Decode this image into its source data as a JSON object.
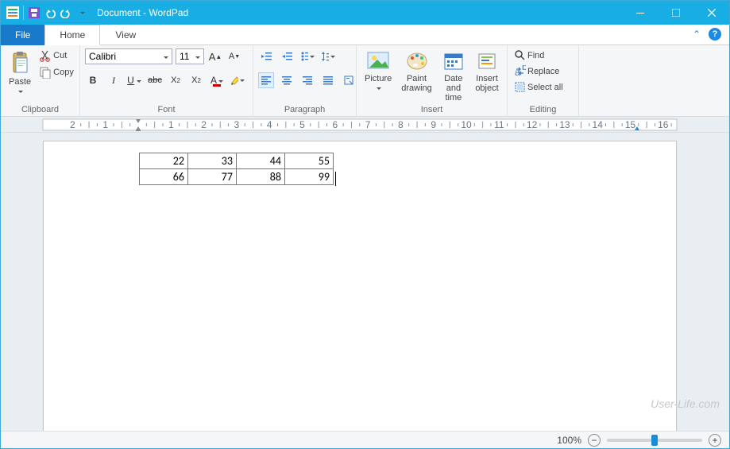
{
  "window": {
    "title": "Document - WordPad"
  },
  "tabs": {
    "file": "File",
    "home": "Home",
    "view": "View"
  },
  "ribbon": {
    "clipboard": {
      "label": "Clipboard",
      "paste": "Paste",
      "cut": "Cut",
      "copy": "Copy"
    },
    "font": {
      "label": "Font",
      "name": "Calibri",
      "size": "11"
    },
    "paragraph": {
      "label": "Paragraph"
    },
    "insert": {
      "label": "Insert",
      "picture": "Picture",
      "paint": "Paint drawing",
      "datetime": "Date and time",
      "object": "Insert object"
    },
    "editing": {
      "label": "Editing",
      "find": "Find",
      "replace": "Replace",
      "selectall": "Select all"
    }
  },
  "document": {
    "table": {
      "rows": [
        [
          "22",
          "33",
          "44",
          "55"
        ],
        [
          "66",
          "77",
          "88",
          "99"
        ]
      ]
    }
  },
  "status": {
    "zoom": "100%"
  },
  "watermark": "User-Life.com"
}
